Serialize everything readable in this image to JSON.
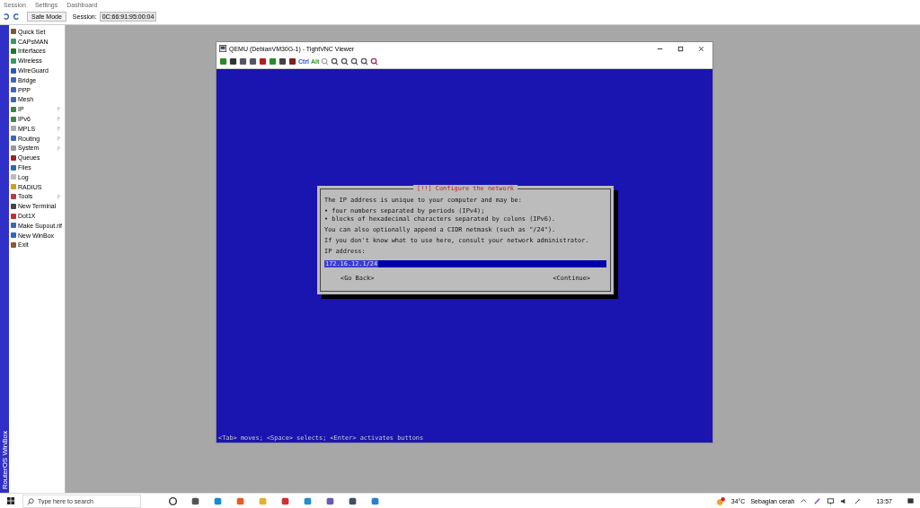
{
  "menu": [
    "Session",
    "Settings",
    "Dashboard"
  ],
  "toolbar": {
    "safe_mode": "Safe Mode",
    "session_label": "Session:",
    "session_value": "0C:66:91:95:00:04"
  },
  "brand": "RouterOS WinBox",
  "sidebar": {
    "items": [
      {
        "label": "Quick Set",
        "has_submenu": false
      },
      {
        "label": "CAPsMAN",
        "has_submenu": false
      },
      {
        "label": "Interfaces",
        "has_submenu": false
      },
      {
        "label": "Wireless",
        "has_submenu": false
      },
      {
        "label": "WireGuard",
        "has_submenu": false
      },
      {
        "label": "Bridge",
        "has_submenu": false
      },
      {
        "label": "PPP",
        "has_submenu": false
      },
      {
        "label": "Mesh",
        "has_submenu": false
      },
      {
        "label": "IP",
        "has_submenu": true
      },
      {
        "label": "IPv6",
        "has_submenu": true
      },
      {
        "label": "MPLS",
        "has_submenu": true
      },
      {
        "label": "Routing",
        "has_submenu": true
      },
      {
        "label": "System",
        "has_submenu": true
      },
      {
        "label": "Queues",
        "has_submenu": false
      },
      {
        "label": "Files",
        "has_submenu": false
      },
      {
        "label": "Log",
        "has_submenu": false
      },
      {
        "label": "RADIUS",
        "has_submenu": false
      },
      {
        "label": "Tools",
        "has_submenu": true
      },
      {
        "label": "New Terminal",
        "has_submenu": false
      },
      {
        "label": "Dot1X",
        "has_submenu": false
      },
      {
        "label": "Make Supout.rif",
        "has_submenu": false
      },
      {
        "label": "New WinBox",
        "has_submenu": false
      },
      {
        "label": "Exit",
        "has_submenu": false
      }
    ]
  },
  "vnc_window": {
    "title": "QEMU (DebianVM30G-1) - TightVNC Viewer",
    "keys": [
      "Ctrl",
      "Alt"
    ],
    "dialog": {
      "title": "[!!] Configure the network",
      "intro": "The IP address is unique to your computer and may be:",
      "bullets": [
        "• four numbers separated by periods (IPv4);",
        "• blocks of hexadecimal characters separated by colons (IPv6)."
      ],
      "paragraphs": [
        "You can also optionally append a CIDR netmask (such as \"/24\").",
        "If you don't know what to use here, consult your network administrator."
      ],
      "field_label": "IP address:",
      "field_value": "172.16.12.1/24",
      "buttons": [
        "<Go Back>",
        "<Continue>"
      ]
    },
    "hint": "<Tab> moves; <Space> selects; <Enter> activates buttons"
  },
  "taskbar": {
    "search_placeholder": "Type here to search",
    "weather": "34°C",
    "weather_text": "Sebagian cerah",
    "time": "13:57"
  }
}
